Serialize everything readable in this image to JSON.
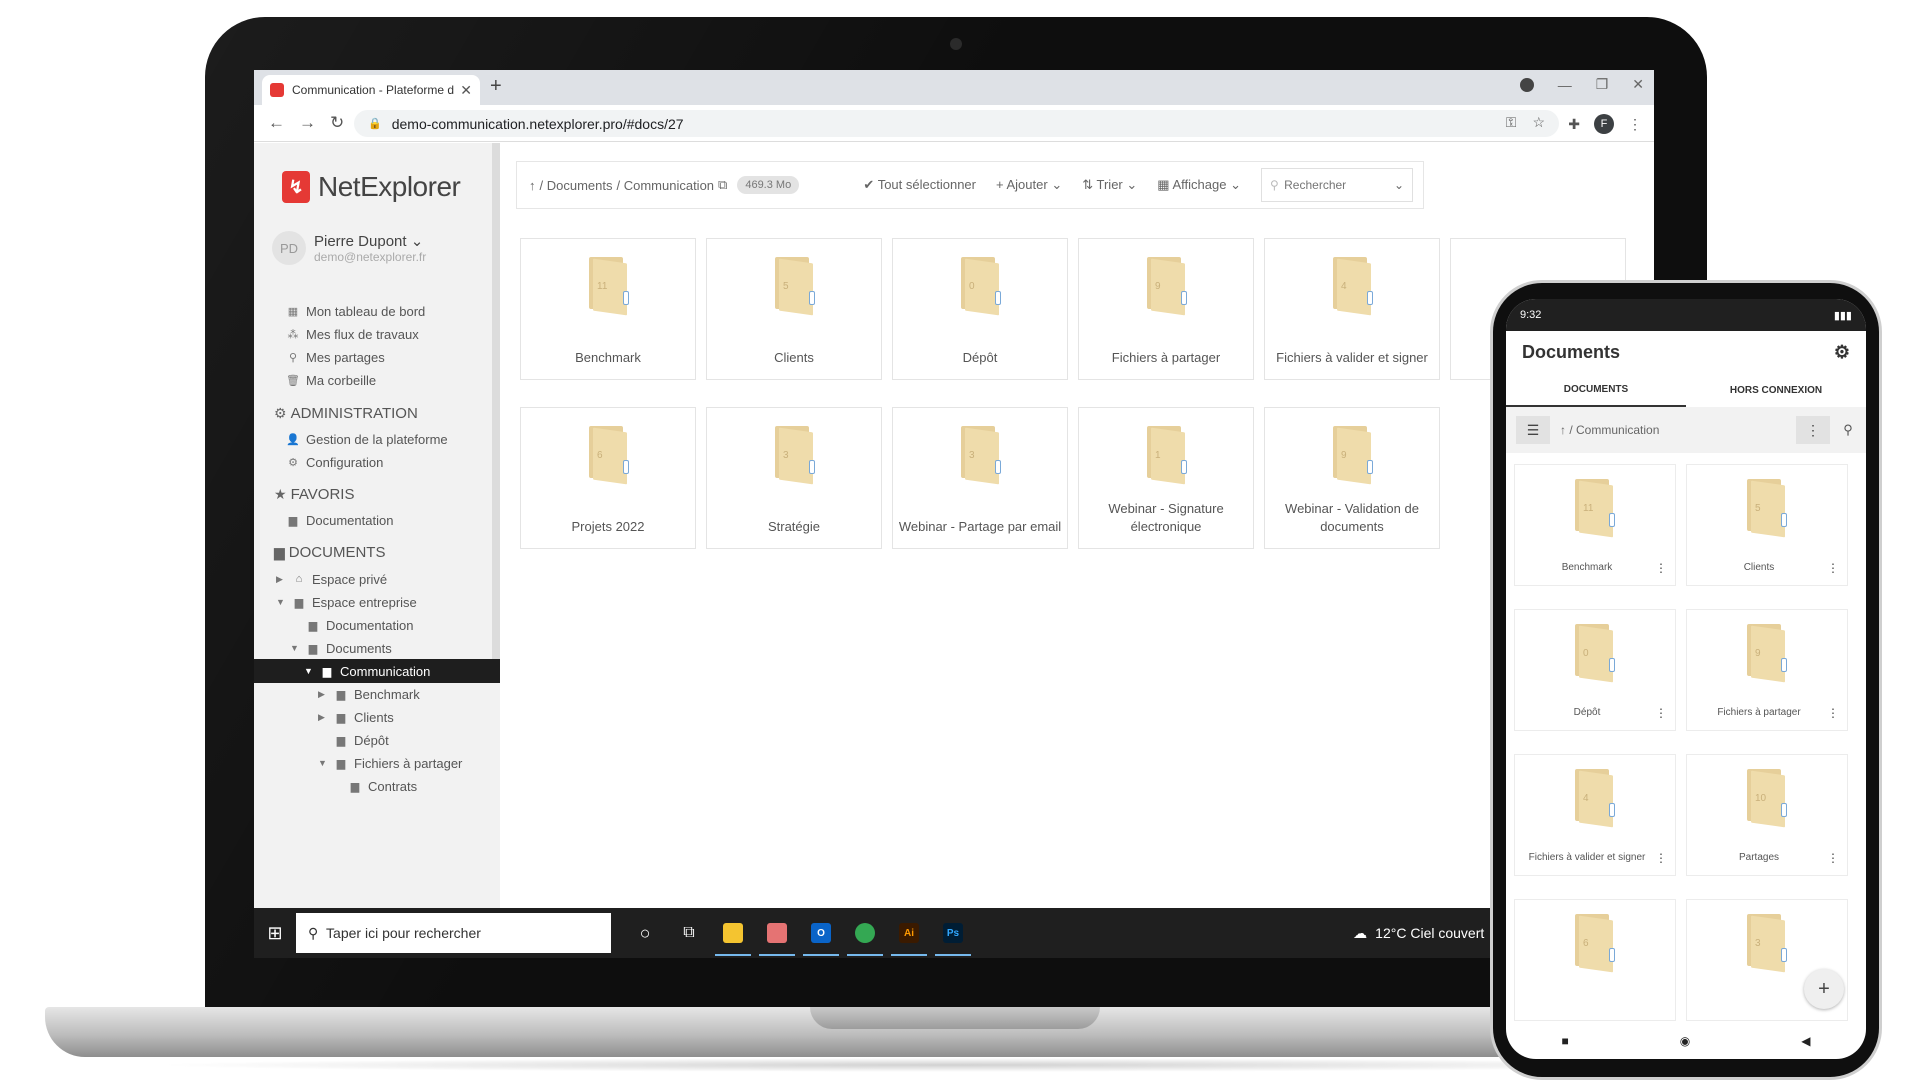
{
  "browser": {
    "tab_title": "Communication - Plateforme de",
    "new_tab": "+",
    "url": "demo-communication.netexplorer.pro/#docs/27",
    "profile_initial": "F"
  },
  "sidebar": {
    "logo": "NetExplorer",
    "user_initials": "PD",
    "user_name": "Pierre Dupont",
    "user_email": "demo@netexplorer.fr",
    "menu": [
      {
        "label": "Mon tableau de bord",
        "icon": "dashboard-icon"
      },
      {
        "label": "Mes flux de travaux",
        "icon": "workflow-icon"
      },
      {
        "label": "Mes partages",
        "icon": "share-icon"
      },
      {
        "label": "Ma corbeille",
        "icon": "trash-icon"
      }
    ],
    "admin_header": "ADMINISTRATION",
    "admin": [
      "Gestion de la plateforme",
      "Configuration"
    ],
    "favoris_header": "FAVORIS",
    "favoris": [
      "Documentation"
    ],
    "documents_header": "DOCUMENTS",
    "tree": [
      "Espace privé",
      "Espace entreprise",
      "Documentation",
      "Documents",
      "Communication",
      "Benchmark",
      "Clients",
      "Dépôt",
      "Fichiers à partager",
      "Contrats"
    ]
  },
  "toolbar": {
    "crumb_root": "/ Documents",
    "crumb_current": "/ Communication",
    "size": "469.3 Mo",
    "select_all": "Tout sélectionner",
    "add": "Ajouter",
    "sort": "Trier",
    "display": "Affichage",
    "search_placeholder": "Rechercher"
  },
  "folders": [
    {
      "name": "Benchmark",
      "count": "11"
    },
    {
      "name": "Clients",
      "count": "5"
    },
    {
      "name": "Dépôt",
      "count": "0"
    },
    {
      "name": "Fichiers à partager",
      "count": "9"
    },
    {
      "name": "Fichiers à valider et signer",
      "count": "4"
    },
    {
      "name": "Projets 2022",
      "count": "6"
    },
    {
      "name": "Stratégie",
      "count": "3"
    },
    {
      "name": "Webinar - Partage par email",
      "count": "3"
    },
    {
      "name": "Webinar - Signature électronique",
      "count": "1"
    },
    {
      "name": "Webinar - Validation de documents",
      "count": "9"
    }
  ],
  "taskbar": {
    "search_text": "Taper ici pour rechercher",
    "weather": "12°C  Ciel couvert"
  },
  "phone": {
    "time": "9:32",
    "title": "Documents",
    "tab_documents": "DOCUMENTS",
    "tab_offline": "HORS CONNEXION",
    "crumb": "/ Communication",
    "folders": [
      {
        "name": "Benchmark",
        "count": "11"
      },
      {
        "name": "Clients",
        "count": "5"
      },
      {
        "name": "Dépôt",
        "count": "0"
      },
      {
        "name": "Fichiers à partager",
        "count": "9"
      },
      {
        "name": "Fichiers à valider et signer",
        "count": "4"
      },
      {
        "name": "Partages",
        "count": "10"
      },
      {
        "name": "",
        "count": "6"
      },
      {
        "name": "",
        "count": "3"
      }
    ],
    "fab": "+"
  },
  "colors": {
    "brand": "#e53935",
    "active_nav": "#1e1e1e",
    "folder": "#efdcab"
  }
}
